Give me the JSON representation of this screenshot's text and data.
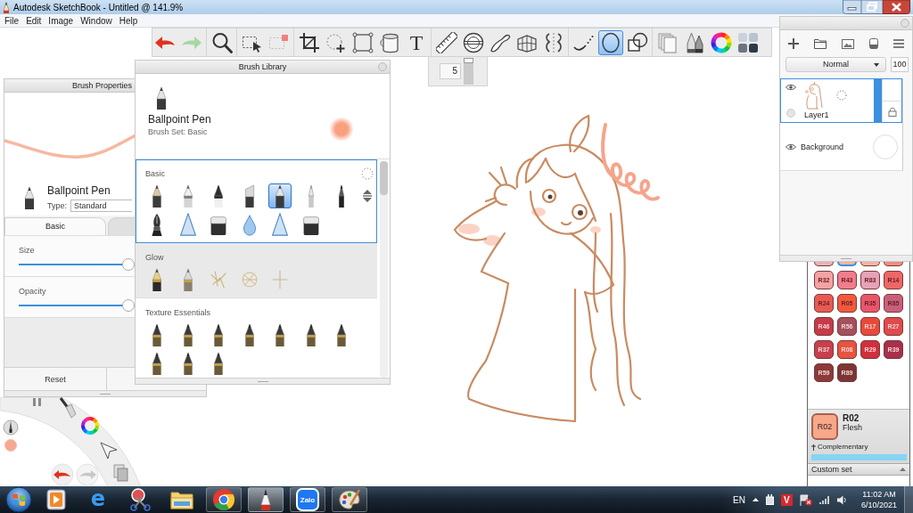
{
  "window": {
    "title": "Autodesk SketchBook - Untitled @ 141.9%"
  },
  "menu": [
    {
      "label": "File"
    },
    {
      "label": "Edit"
    },
    {
      "label": "Image"
    },
    {
      "label": "Window"
    },
    {
      "label": "Help"
    }
  ],
  "toolbar": {
    "groups": [
      {
        "tools": [
          {
            "kind": "undo",
            "selected": false
          },
          {
            "kind": "redo",
            "selected": false
          }
        ]
      },
      {
        "tools": [
          {
            "kind": "zoom",
            "selected": false
          }
        ]
      },
      {
        "tools": [
          {
            "kind": "marquee",
            "selected": false
          },
          {
            "kind": "deselect",
            "selected": false
          }
        ]
      },
      {
        "tools": [
          {
            "kind": "crop",
            "selected": false
          },
          {
            "kind": "transform",
            "selected": false
          },
          {
            "kind": "distort",
            "selected": false
          },
          {
            "kind": "fill",
            "selected": false
          },
          {
            "kind": "text",
            "glyph": "T",
            "selected": false
          }
        ]
      },
      {
        "tools": [
          {
            "kind": "ruler",
            "selected": false
          },
          {
            "kind": "ellipseguide",
            "selected": false
          },
          {
            "kind": "curve",
            "selected": false
          },
          {
            "kind": "perspective",
            "selected": false
          },
          {
            "kind": "symmetry",
            "selected": false
          }
        ]
      },
      {
        "tools": [
          {
            "kind": "stroke",
            "selected": false
          },
          {
            "kind": "ellipse",
            "selected": true
          },
          {
            "kind": "shape",
            "selected": false
          }
        ]
      },
      {
        "tools": [
          {
            "kind": "layers",
            "selected": false
          },
          {
            "kind": "brushes",
            "selected": false
          },
          {
            "kind": "colorwheel",
            "selected": false
          },
          {
            "kind": "swatches",
            "selected": false
          }
        ]
      }
    ]
  },
  "size_popup": {
    "value": "5",
    "level": 1
  },
  "brush_properties": {
    "title": "Brush Properties",
    "brush_name": "Ballpoint Pen",
    "type_label": "Type:",
    "type_value": "Standard",
    "tabs": [
      {
        "label": "Basic",
        "selected": true
      },
      {
        "selected": false
      }
    ],
    "sliders": [
      {
        "label": "Size",
        "level": 0.95
      },
      {
        "label": "Opacity",
        "level": 0.95
      }
    ],
    "reset": "Reset"
  },
  "brush_library": {
    "title": "Brush Library",
    "brush_name": "Ballpoint Pen",
    "brush_set": "Brush Set: Basic",
    "sections": [
      {
        "title": "Basic",
        "selected": true,
        "hovered": false,
        "brushes": [
          {
            "kind": "pencil",
            "selected": false
          },
          {
            "kind": "technical",
            "selected": false
          },
          {
            "kind": "marker",
            "selected": false
          },
          {
            "kind": "chisel",
            "selected": false
          },
          {
            "kind": "ballpoint",
            "selected": true
          },
          {
            "kind": "paintbrush",
            "selected": false
          },
          {
            "kind": "fineliner",
            "selected": false
          },
          {
            "kind": "fountain",
            "selected": false
          },
          {
            "kind": "airbrush",
            "selected": false
          },
          {
            "kind": "block",
            "selected": false
          },
          {
            "kind": "drop",
            "selected": false
          },
          {
            "kind": "cone",
            "selected": false
          },
          {
            "kind": "eraser",
            "selected": false
          }
        ]
      },
      {
        "title": "Glow",
        "selected": false,
        "hovered": true,
        "brushes": [
          {
            "kind": "glowpen",
            "selected": false
          },
          {
            "kind": "glowbrush",
            "selected": false
          },
          {
            "kind": "sparks",
            "selected": false
          },
          {
            "kind": "web",
            "selected": false
          },
          {
            "kind": "cross",
            "selected": false
          }
        ]
      },
      {
        "title": "Texture Essentials",
        "selected": false,
        "hovered": false,
        "brushes": [
          {
            "kind": "texture",
            "selected": false
          },
          {
            "kind": "texture",
            "selected": false
          },
          {
            "kind": "texture",
            "selected": false
          },
          {
            "kind": "texture",
            "selected": false
          },
          {
            "kind": "texture",
            "selected": false
          },
          {
            "kind": "texture",
            "selected": false
          },
          {
            "kind": "texture",
            "selected": false
          },
          {
            "kind": "texture",
            "selected": false
          },
          {
            "kind": "texture",
            "selected": false
          },
          {
            "kind": "texture",
            "selected": false
          }
        ]
      }
    ]
  },
  "layers": {
    "blend_mode": "Normal",
    "opacity": "100",
    "items": [
      {
        "kind": "paint",
        "name": "Layer1",
        "visible": true,
        "selected": true
      },
      {
        "kind": "background",
        "name": "Background",
        "visible": true,
        "selected": false
      }
    ]
  },
  "color_palette": {
    "rows": [
      {
        "clipped": true,
        "swatches": [
          {
            "color": "#e9b2b4",
            "selected": false
          },
          {
            "color": "#f4b69c",
            "selected": true
          },
          {
            "color": "#f2b4a4",
            "selected": false
          },
          {
            "color": "#ee8e80",
            "selected": false
          }
        ]
      },
      {
        "clipped": false,
        "swatches": [
          {
            "label": "R32",
            "color": "#f4a2a2",
            "selected": false
          },
          {
            "label": "R43",
            "color": "#f07c8c",
            "selected": false
          },
          {
            "label": "R83",
            "color": "#e6a2b6",
            "selected": false
          },
          {
            "label": "R14",
            "color": "#ee6666",
            "selected": false
          }
        ]
      },
      {
        "clipped": false,
        "swatches": [
          {
            "label": "R24",
            "color": "#e85a52",
            "selected": false
          },
          {
            "label": "R05",
            "color": "#f05a3c",
            "selected": false
          },
          {
            "label": "R35",
            "color": "#e8566a",
            "selected": false
          },
          {
            "label": "R85",
            "color": "#c8607c",
            "selected": false
          }
        ]
      },
      {
        "clipped": false,
        "swatches": [
          {
            "label": "R46",
            "color": "#c63a4a",
            "selected": false
          },
          {
            "label": "R56",
            "color": "#a4505e",
            "selected": false
          },
          {
            "label": "R17",
            "color": "#e84a3a",
            "selected": false
          },
          {
            "label": "R27",
            "color": "#e04a4c",
            "selected": false
          }
        ]
      },
      {
        "clipped": false,
        "swatches": [
          {
            "label": "R37",
            "color": "#c6404e",
            "selected": false
          },
          {
            "label": "R08",
            "color": "#e8543e",
            "selected": false
          },
          {
            "label": "R29",
            "color": "#d0303e",
            "selected": false
          },
          {
            "label": "R39",
            "color": "#a8304a",
            "selected": false
          }
        ]
      },
      {
        "clipped": false,
        "swatches": [
          {
            "label": "R59",
            "color": "#8a3a3a",
            "selected": false
          },
          {
            "label": "R89",
            "color": "#7a3634",
            "selected": false
          }
        ]
      }
    ],
    "current": {
      "label": "R02",
      "code": "R02",
      "name": "Flesh"
    },
    "complementary": "Complementary",
    "set": "Custom set"
  },
  "taskbar": {
    "apps": [
      {
        "kind": "mediaplayer",
        "running": false,
        "selected": false
      },
      {
        "kind": "ie",
        "glyph": "e",
        "running": false,
        "selected": false
      },
      {
        "kind": "snipping",
        "running": false,
        "selected": false
      },
      {
        "kind": "explorer",
        "running": false,
        "selected": false
      },
      {
        "kind": "chrome",
        "running": true,
        "selected": false
      },
      {
        "kind": "sketchbook",
        "running": true,
        "selected": true
      },
      {
        "kind": "zalo",
        "glyph": "Zalo",
        "running": true,
        "selected": false
      },
      {
        "kind": "paint",
        "running": true,
        "selected": false
      }
    ],
    "language": "EN",
    "badge": "V",
    "time": "11:02 AM",
    "date": "6/10/2021"
  }
}
